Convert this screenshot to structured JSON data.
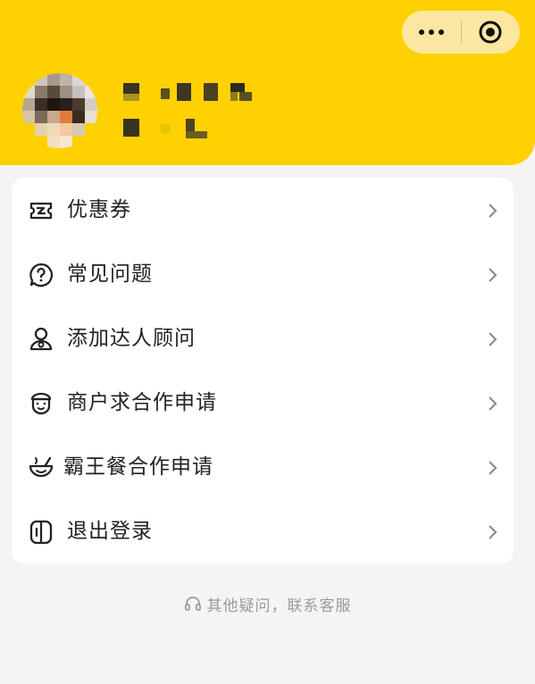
{
  "menu": {
    "items": [
      {
        "label": "优惠券",
        "icon": "coupon-icon"
      },
      {
        "label": "常见问题",
        "icon": "question-bubble-icon"
      },
      {
        "label": "添加达人顾问",
        "icon": "user-advisor-icon"
      },
      {
        "label": "商户求合作申请",
        "icon": "merchant-icon"
      },
      {
        "label": "霸王餐合作申请",
        "icon": "bowl-icon"
      },
      {
        "label": "退出登录",
        "icon": "logout-icon"
      }
    ]
  },
  "footer": {
    "text": "其他疑问，联系客服",
    "icon": "headset-icon"
  },
  "colors": {
    "header": "#ffd100",
    "background": "#f4f4f4",
    "card": "#ffffff",
    "text": "#222222",
    "muted": "#9a9a9a"
  }
}
